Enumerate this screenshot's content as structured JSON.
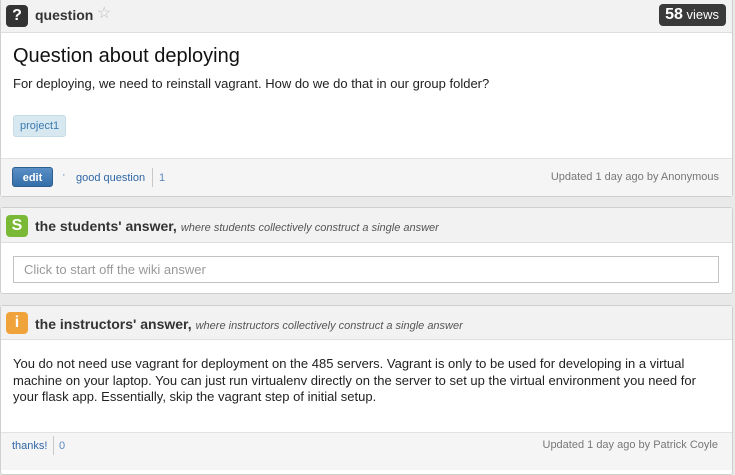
{
  "question": {
    "type_label": "question",
    "icon_glyph": "?",
    "star_icon": "star-icon",
    "views_count": "58",
    "views_label": "views",
    "title": "Question about deploying",
    "body": "For deploying, we need to reinstall vagrant. How do we do that in our group folder?",
    "tag": "project1",
    "edit_label": "edit",
    "good_question_label": "good question",
    "good_question_count": "1",
    "updated": "Updated 1 day ago by Anonymous"
  },
  "students_answer": {
    "icon_glyph": "S",
    "title": "the students' answer,",
    "subtitle": "where students collectively construct a single answer",
    "placeholder": "Click to start off the wiki answer"
  },
  "instructors_answer": {
    "icon_glyph": "i",
    "title": "the instructors' answer,",
    "subtitle": "where instructors collectively construct a single answer",
    "body": "You do not need use vagrant for deployment on the 485 servers. Vagrant is only to be used for developing in a virtual machine on your laptop. You can just run virtualenv directly on the server to set up the virtual environment you need for your flask app. Essentially, skip the vagrant step of initial setup.",
    "thanks_label": "thanks!",
    "thanks_count": "0",
    "updated": "Updated 1 day ago by Patrick Coyle"
  },
  "colors": {
    "question_icon": "#333333",
    "students_icon": "#7ab935",
    "instructors_icon": "#f0a33a",
    "link": "#2f67a7",
    "button": "#346ea9"
  }
}
